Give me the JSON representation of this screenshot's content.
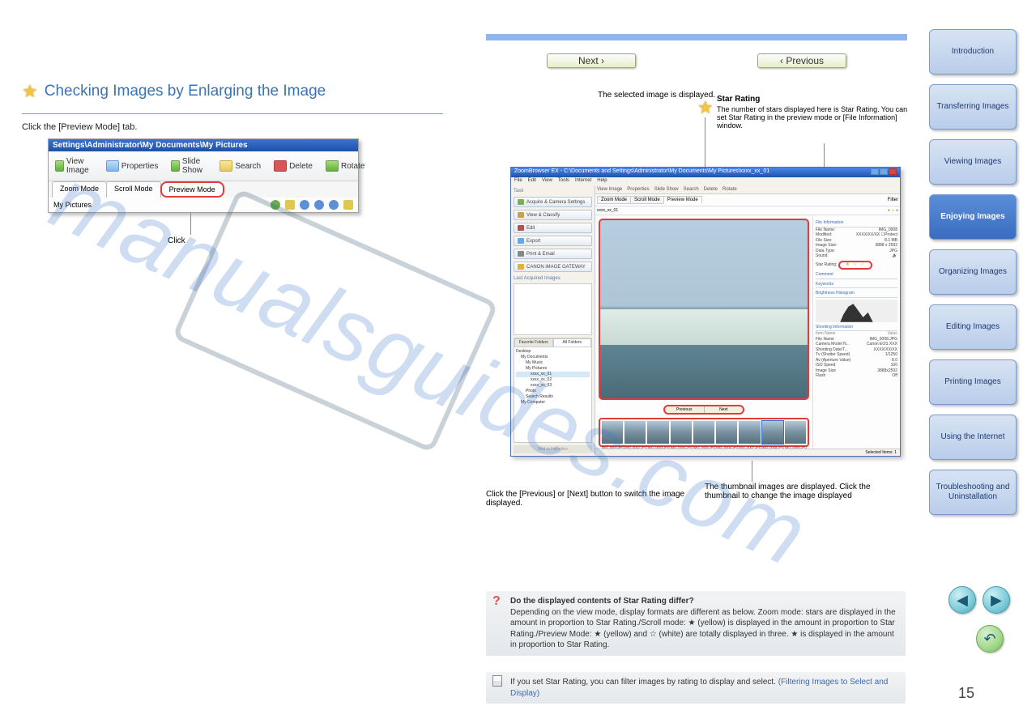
{
  "section": {
    "title": "Checking Images by Enlarging the Image"
  },
  "step1": {
    "text": "Click the [Preview Mode] tab."
  },
  "toolbar_screenshot": {
    "path": "Settings\\Administrator\\My Documents\\My Pictures",
    "buttons": {
      "view_image": "View Image",
      "properties": "Properties",
      "slide_show": "Slide Show",
      "search": "Search",
      "delete": "Delete",
      "rotate": "Rotate"
    },
    "tabs": {
      "zoom": "Zoom Mode",
      "scroll": "Scroll Mode",
      "preview": "Preview Mode"
    },
    "breadcrumb": "My Pictures"
  },
  "callout_tabs": "Click",
  "nav_buttons": {
    "next": "Next  ›",
    "previous": "‹  Previous"
  },
  "right_captions": {
    "preview": "The selected image is displayed.",
    "rating_title": "Star Rating",
    "rating_body": "The number of stars displayed here is Star Rating. You can set Star Rating in the preview mode or [File Information] window.",
    "prevnext": "Click the [Previous] or [Next] button to switch the image displayed.",
    "thumbs": "The thumbnail images are displayed. Click the thumbnail to change the image displayed"
  },
  "app_window": {
    "title": "ZoomBrowser EX - C:\\Documents and Settings\\Administrator\\My Documents\\My Pictures\\xxxx_xx_01",
    "menu": [
      "File",
      "Edit",
      "View",
      "Tools",
      "Internet",
      "Help"
    ],
    "tasks_header": "Task",
    "task_buttons": [
      "Acquire & Camera Settings",
      "View & Classify",
      "Edit",
      "Export",
      "Print & Email",
      "CANON iMAGE GATEWAY"
    ],
    "last_acquired": "Last Acquired Images",
    "folder_tabs": {
      "favorite": "Favorite Folders",
      "all": "All Folders"
    },
    "folders": [
      "Desktop",
      "My Documents",
      "My Music",
      "My Pictures",
      "xxxx_xx_01",
      "xxxx_xx_02",
      "xxxx_xx_03",
      "Photo",
      "Search Results",
      "My Computer"
    ],
    "main_toolbar": [
      "View Image",
      "Properties",
      "Slide Show",
      "Search",
      "Delete",
      "Rotate"
    ],
    "mode_tabs": {
      "zoom": "Zoom Mode",
      "scroll": "Scroll Mode",
      "preview": "Preview Mode"
    },
    "breadcrumb": "xxxx_xx_01",
    "filter": "Filter",
    "prevnext": {
      "prev": "Previous",
      "next": "Next"
    },
    "info_section": "File Information",
    "info": {
      "file_name_k": "File Name:",
      "file_name_v": "IMG_0008",
      "modified_k": "Modified:",
      "modified_v": "XXXX/XX/XX",
      "protect": "Protect",
      "file_size_k": "File Size:",
      "file_size_v": "8.1 MB",
      "image_size_k": "Image Size:",
      "image_size_v": "3888 x 2592",
      "data_type_k": "Data Type:",
      "data_type_v": "JPG",
      "sound_k": "Sound:"
    },
    "rating_k": "Star Rating:",
    "comment_k": "Comment",
    "keywords_k": "Keywords",
    "histogram_k": "Brightness Histogram",
    "shooting_k": "Shooting Information",
    "shooting": {
      "item_name_k": "Item Name",
      "item_value_k": "Value",
      "file_name_k": "File Name",
      "file_name_v": "IMG_0008.JPG",
      "camera_k": "Camera Model N...",
      "camera_v": "Canon EOS XXX",
      "date_k": "Shooting Date/T...",
      "date_v": "XXXX/XX/XX",
      "tv_k": "Tv (Shutter Speed)",
      "tv_v": "1/1250",
      "av_k": "Av (Aperture Value)",
      "av_v": "8.0",
      "iso_k": "ISO Speed",
      "iso_v": "100",
      "isize_k": "Image Size",
      "isize_v": "3888x2592",
      "flash_k": "Flash",
      "flash_v": "Off"
    },
    "thumbs": [
      "IMG_0001.JPG",
      "IMG_0002.JPG",
      "IMG_0003.JPG",
      "IMG_0004.JPG",
      "IMG_0005.JPG",
      "IMG_0006.JPG",
      "IMG_0007.JPG",
      "IMG_0008.JPG",
      "IMG_0009.JPG"
    ],
    "statusbar": "Selected Items: 1"
  },
  "faq": {
    "title": "Do the displayed contents of Star Rating differ?",
    "body": "Depending on the view mode, display formats are different as below. Zoom mode: stars are displayed in the amount in proportion to Star Rating./Scroll mode: ★ (yellow) is displayed in the amount in proportion to Star Rating./Preview Mode: ★ (yellow) and ☆ (white) are totally displayed in three. ★ is displayed in the amount in proportion to Star Rating."
  },
  "note": {
    "body": "If you set Star Rating, you can filter images by rating to display and select.",
    "link": "(Filtering Images to Select and Display)"
  },
  "side_nav": {
    "intro": "Introduction",
    "transfer": "Transferring Images",
    "viewing": "Viewing Images",
    "enjoying": "Enjoying Images",
    "organizing": "Organizing Images",
    "editing": "Editing Images",
    "printing": "Printing Images",
    "internet": "Using the Internet",
    "troubleshooting": "Troubleshooting and Uninstallation"
  },
  "page_number": "15"
}
